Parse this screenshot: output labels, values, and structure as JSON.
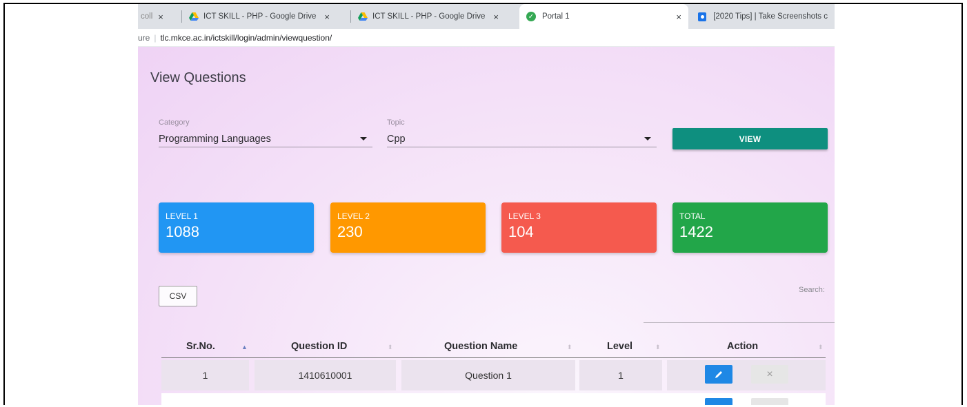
{
  "tabs": [
    {
      "label": "coll",
      "close": "×"
    },
    {
      "label": "ICT SKILL - PHP - Google Drive",
      "close": "×",
      "icon": "google-drive-icon"
    },
    {
      "label": "ICT SKILL - PHP - Google Drive",
      "close": "×",
      "icon": "google-drive-icon"
    },
    {
      "label": "Portal 1",
      "close": "×",
      "icon": "check-circle-icon",
      "active": true
    },
    {
      "label": "[2020 Tips] | Take Screenshots c",
      "icon": "site-icon"
    }
  ],
  "address": {
    "secure": "ure",
    "url": "tlc.mkce.ac.in/ictskill/login/admin/viewquestion/"
  },
  "page": {
    "title": "View Questions"
  },
  "filters": {
    "category_label": "Category",
    "category_value": "Programming Languages",
    "topic_label": "Topic",
    "topic_value": "Cpp",
    "view_button": "VIEW"
  },
  "stats": [
    {
      "label": "LEVEL 1",
      "value": "1088",
      "color": "#2196f3"
    },
    {
      "label": "LEVEL 2",
      "value": "230",
      "color": "#ff9800"
    },
    {
      "label": "LEVEL 3",
      "value": "104",
      "color": "#f55a4e"
    },
    {
      "label": "TOTAL",
      "value": "1422",
      "color": "#22a649"
    }
  ],
  "table_controls": {
    "csv_button": "CSV",
    "search_label": "Search:"
  },
  "table": {
    "headers": [
      "Sr.No.",
      "Question ID",
      "Question Name",
      "Level",
      "Action"
    ],
    "rows": [
      {
        "srno": "1",
        "question_id": "1410610001",
        "question_name": "Question 1",
        "level": "1"
      }
    ]
  },
  "colors": {
    "view_button": "#0e8f7f",
    "edit_button": "#1e88e5"
  }
}
